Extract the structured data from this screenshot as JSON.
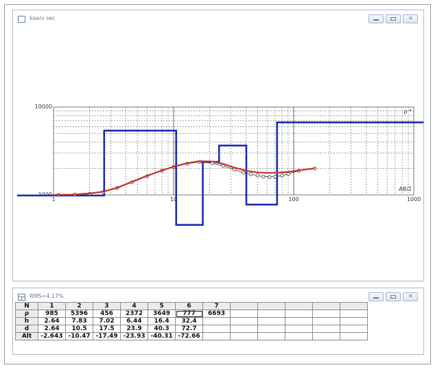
{
  "chart_window": {
    "title": "kaani sec",
    "buttons": [
      "minimize-button",
      "maximize-button",
      "close-button"
    ]
  },
  "table_window": {
    "title": "RMS=4.17%",
    "close_glyph": "✕"
  },
  "chart_data": {
    "type": "line",
    "x_scale": "log",
    "y_scale": "log",
    "xlim": [
      1,
      1000
    ],
    "ylim": [
      1000,
      10000
    ],
    "x_tick_labels": [
      "1",
      "10",
      "100",
      "1000"
    ],
    "y_tick_labels": [
      "10000",
      "1000"
    ],
    "y_axis_label": "ρ *",
    "x_axis_label": "AB/2",
    "grid": true,
    "series": [
      {
        "role": "layered-model",
        "color": "#1c2bb5",
        "layer_resistivity": [
          985,
          5396,
          456,
          2372,
          3649,
          777,
          6693
        ],
        "layer_bottom_depth": [
          2.64,
          10.5,
          17.5,
          23.9,
          40.3,
          72.7
        ]
      },
      {
        "role": "observed-points",
        "color": "#333333",
        "points": [
          [
            1.1,
            1000
          ],
          [
            1.5,
            1010
          ],
          [
            2.0,
            1030
          ],
          [
            2.6,
            1080
          ],
          [
            3.4,
            1200
          ],
          [
            4.5,
            1390
          ],
          [
            6.0,
            1630
          ],
          [
            8.0,
            1880
          ],
          [
            10,
            2080
          ],
          [
            13,
            2270
          ],
          [
            16.5,
            2370
          ],
          [
            21,
            2300
          ],
          [
            26,
            2140
          ],
          [
            32,
            1940
          ],
          [
            38,
            1800
          ],
          [
            44,
            1720
          ],
          [
            50,
            1660
          ],
          [
            56,
            1620
          ],
          [
            63,
            1600
          ],
          [
            70,
            1610
          ],
          [
            80,
            1660
          ],
          [
            90,
            1730
          ],
          [
            110,
            1880
          ],
          [
            150,
            2010
          ]
        ]
      },
      {
        "role": "calculated-curve",
        "color": "#c0302b",
        "points": [
          [
            1.0,
            1000
          ],
          [
            1.5,
            1010
          ],
          [
            2.0,
            1040
          ],
          [
            2.6,
            1090
          ],
          [
            3.4,
            1210
          ],
          [
            4.5,
            1410
          ],
          [
            6.0,
            1650
          ],
          [
            8.0,
            1900
          ],
          [
            10,
            2100
          ],
          [
            13,
            2300
          ],
          [
            16.5,
            2420
          ],
          [
            21,
            2400
          ],
          [
            26,
            2250
          ],
          [
            32,
            2050
          ],
          [
            40,
            1890
          ],
          [
            50,
            1800
          ],
          [
            60,
            1780
          ],
          [
            75,
            1790
          ],
          [
            90,
            1830
          ],
          [
            110,
            1900
          ],
          [
            150,
            2010
          ]
        ]
      }
    ]
  },
  "table": {
    "row_headers": [
      "N",
      "ρ",
      "h",
      "d",
      "Alt"
    ],
    "columns": [
      "1",
      "2",
      "3",
      "4",
      "5",
      "6",
      "7",
      "",
      "",
      "",
      "",
      ""
    ],
    "rows": {
      "rho": [
        "985",
        "5396",
        "456",
        "2372",
        "3649",
        "777",
        "6693",
        "",
        "",
        "",
        "",
        ""
      ],
      "h": [
        "2.64",
        "7.83",
        "7.02",
        "6.44",
        "16.4",
        "32.4",
        "",
        "",
        "",
        "",
        "",
        ""
      ],
      "d": [
        "2.64",
        "10.5",
        "17.5",
        "23.9",
        "40.3",
        "72.7",
        "",
        "",
        "",
        "",
        "",
        ""
      ],
      "alt": [
        "-2.643",
        "-10.47",
        "-17.49",
        "-23.93",
        "-40.31",
        "-72.66",
        "",
        "",
        "",
        "",
        "",
        ""
      ]
    },
    "selected_cell": "rho.5"
  }
}
